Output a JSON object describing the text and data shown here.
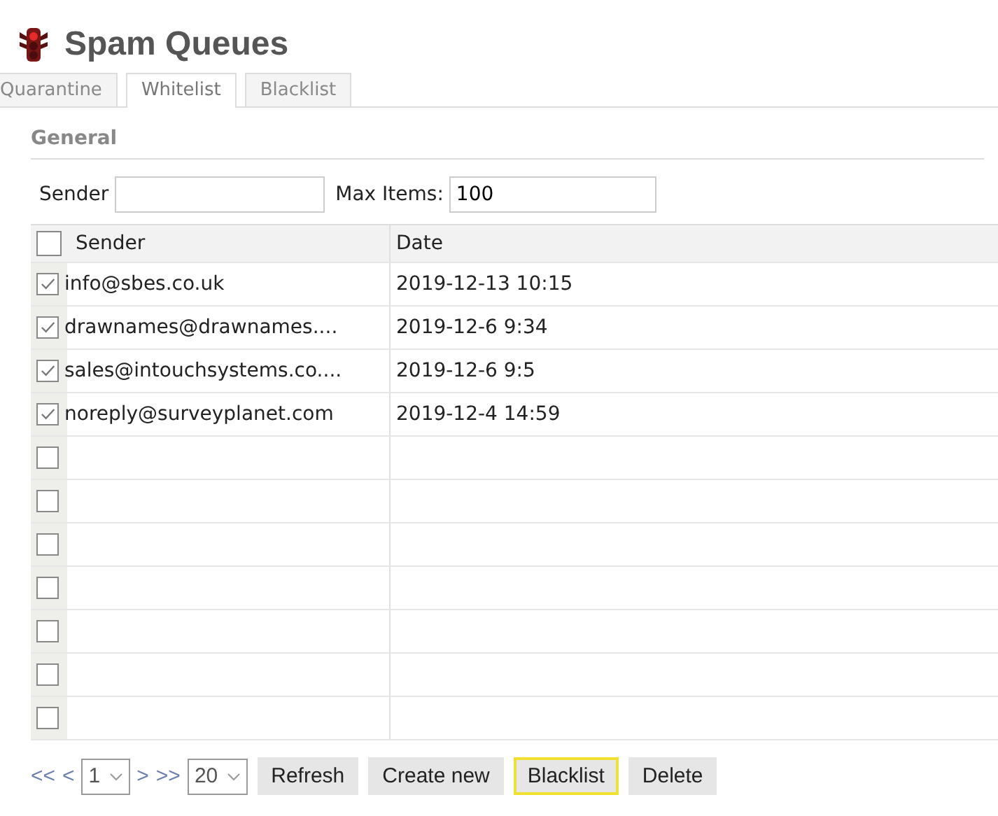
{
  "title": "Spam Queues",
  "tabs": [
    {
      "label": "Quarantine",
      "selected": false
    },
    {
      "label": "Whitelist",
      "selected": true
    },
    {
      "label": "Blacklist",
      "selected": false
    }
  ],
  "section": "General",
  "filters": {
    "sender_label": "Sender",
    "max_items_label": "Max Items:",
    "max_items_value": "100"
  },
  "table": {
    "columns": [
      "Sender",
      "Date"
    ],
    "select_all_checked": false,
    "rows": [
      {
        "checked": true,
        "sender": "info@sbes.co.uk",
        "date": "2019-12-13 10:15"
      },
      {
        "checked": true,
        "sender": "drawnames@drawnames....",
        "date": "2019-12-6 9:34"
      },
      {
        "checked": true,
        "sender": "sales@intouchsystems.co....",
        "date": "2019-12-6 9:5"
      },
      {
        "checked": true,
        "sender": "noreply@surveyplanet.com",
        "date": "2019-12-4 14:59"
      },
      {
        "checked": false
      },
      {
        "checked": false
      },
      {
        "checked": false
      },
      {
        "checked": false
      },
      {
        "checked": false
      },
      {
        "checked": false
      },
      {
        "checked": false
      }
    ]
  },
  "pager": {
    "first": "<<",
    "prev": "<",
    "page": "1",
    "next": ">",
    "last": ">>",
    "page_size": "20"
  },
  "buttons": [
    {
      "label": "Refresh",
      "highlighted": false
    },
    {
      "label": "Create new",
      "highlighted": false
    },
    {
      "label": "Blacklist",
      "highlighted": true
    },
    {
      "label": "Delete",
      "highlighted": false
    }
  ]
}
